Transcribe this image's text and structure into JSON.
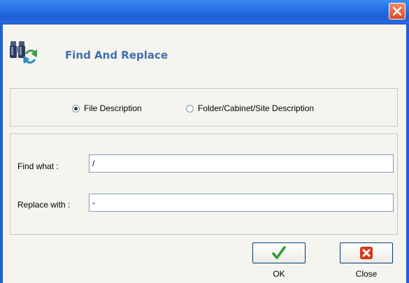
{
  "window": {
    "close_icon": "close-icon"
  },
  "header": {
    "title": "Find And Replace",
    "icon": "binoculars-replace-icon"
  },
  "scope": {
    "options": [
      {
        "label": "File Description",
        "checked": true
      },
      {
        "label": "Folder/Cabinet/Site Description",
        "checked": false
      }
    ]
  },
  "fields": {
    "find_label": "Find what :",
    "find_value": "/",
    "replace_label": "Replace with :",
    "replace_value": "-"
  },
  "buttons": {
    "ok_label": "OK",
    "ok_icon": "checkmark-icon",
    "close_label": "Close",
    "close_icon": "red-x-icon"
  },
  "colors": {
    "titlebar": "#2a72e8",
    "title_text": "#3f6fae",
    "ok_check": "#2f9a2a",
    "close_x": "#d23a1e"
  }
}
